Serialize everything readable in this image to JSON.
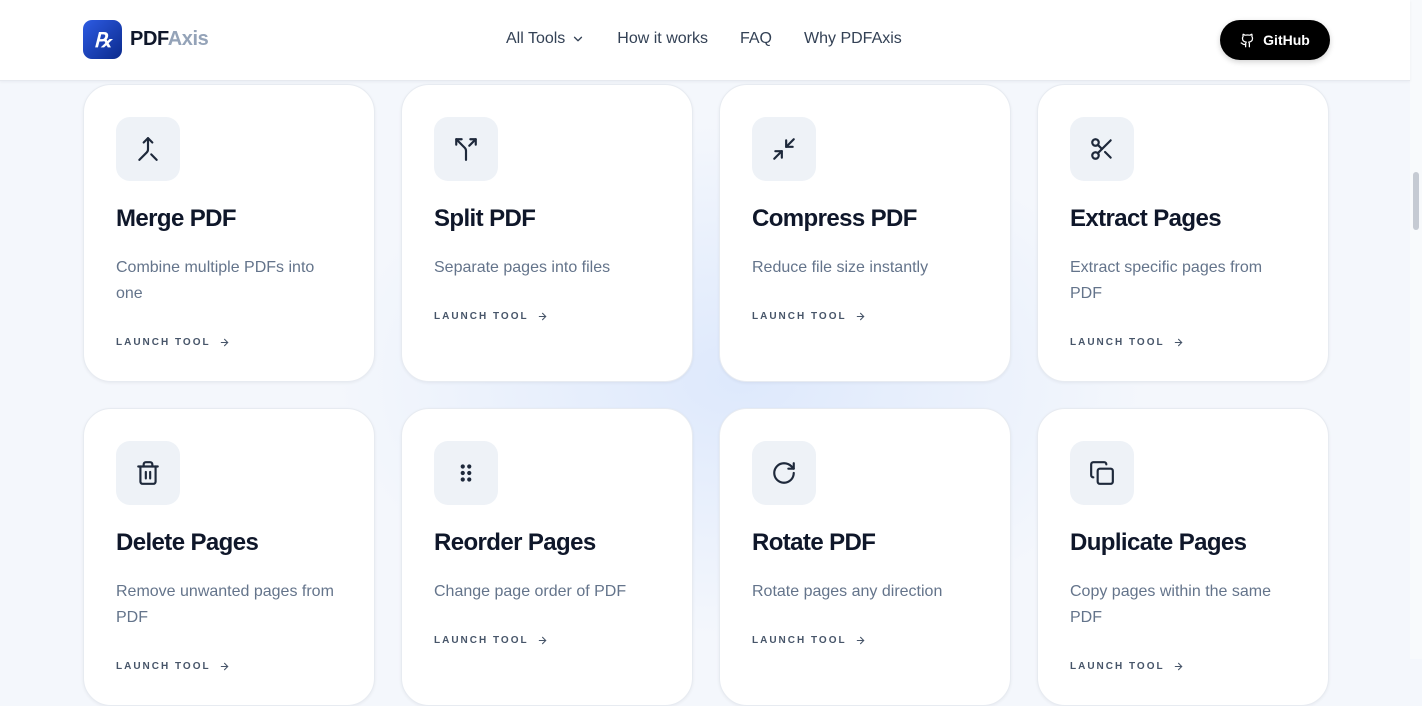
{
  "brand": {
    "name_main": "PDF",
    "name_accent": "Axis",
    "logo_letter": "Rx"
  },
  "nav": {
    "items": [
      {
        "label": "All Tools",
        "has_dropdown": true,
        "icon": "chevron-down-icon"
      },
      {
        "label": "How it works"
      },
      {
        "label": "FAQ"
      },
      {
        "label": "Why PDFAxis"
      }
    ]
  },
  "github": {
    "label": "GitHub",
    "icon": "github-icon"
  },
  "colors": {
    "accent": "#2d5be3",
    "text": "#0f172a",
    "muted": "#64748b",
    "icon_bg": "#eef2f7"
  },
  "tools": [
    {
      "title": "Merge PDF",
      "description": "Combine multiple PDFs into one",
      "action": "LAUNCH TOOL",
      "icon": "merge-icon"
    },
    {
      "title": "Split PDF",
      "description": "Separate pages into files",
      "action": "LAUNCH TOOL",
      "icon": "split-icon"
    },
    {
      "title": "Compress PDF",
      "description": "Reduce file size instantly",
      "action": "LAUNCH TOOL",
      "icon": "compress-icon"
    },
    {
      "title": "Extract Pages",
      "description": "Extract specific pages from PDF",
      "action": "LAUNCH TOOL",
      "icon": "scissors-icon"
    },
    {
      "title": "Delete Pages",
      "description": "Remove unwanted pages from PDF",
      "action": "LAUNCH TOOL",
      "icon": "trash-icon"
    },
    {
      "title": "Reorder Pages",
      "description": "Change page order of PDF",
      "action": "LAUNCH TOOL",
      "icon": "grip-icon"
    },
    {
      "title": "Rotate PDF",
      "description": "Rotate pages any direction",
      "action": "LAUNCH TOOL",
      "icon": "rotate-icon"
    },
    {
      "title": "Duplicate Pages",
      "description": "Copy pages within the same PDF",
      "action": "LAUNCH TOOL",
      "icon": "copy-icon"
    }
  ]
}
